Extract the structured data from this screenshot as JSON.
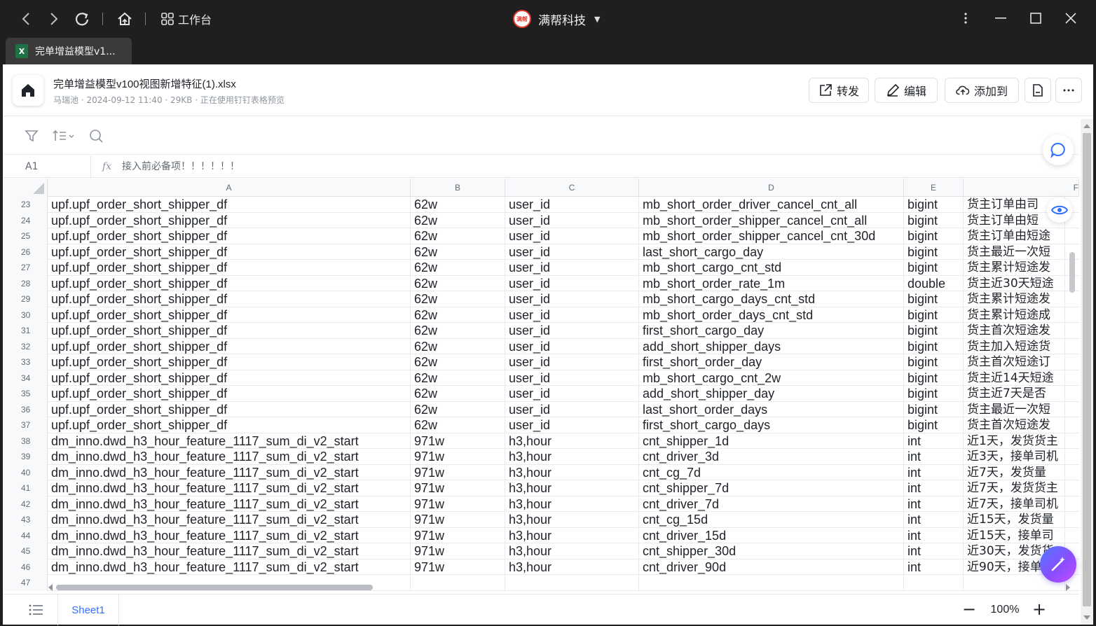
{
  "titlebar": {
    "workbench_label": "工作台",
    "brand_name": "满帮科技",
    "brand_logo_text": "满帮"
  },
  "tab": {
    "title": "完单增益模型v1..."
  },
  "file": {
    "name": "完单增益模型v100视图新增特征(1).xlsx",
    "meta": "马瑞池 · 2024-09-12 11:40 · 29KB · 正在使用钉钉表格预览"
  },
  "actions": {
    "forward": "转发",
    "edit": "编辑",
    "add_to": "添加到"
  },
  "formula_bar": {
    "cell_ref": "A1",
    "fx": "fx",
    "value": "接入前必备项！！！！！！"
  },
  "columns": [
    "A",
    "B",
    "C",
    "D",
    "E",
    "F"
  ],
  "rows": [
    {
      "n": "23",
      "a": "upf.upf_order_short_shipper_df",
      "b": "62w",
      "c": "user_id",
      "d": "mb_short_order_driver_cancel_cnt_all",
      "e": "bigint",
      "f": "货主订单由司"
    },
    {
      "n": "24",
      "a": "upf.upf_order_short_shipper_df",
      "b": "62w",
      "c": "user_id",
      "d": "mb_short_order_shipper_cancel_cnt_all",
      "e": "bigint",
      "f": "货主订单由短"
    },
    {
      "n": "25",
      "a": "upf.upf_order_short_shipper_df",
      "b": "62w",
      "c": "user_id",
      "d": "mb_short_order_shipper_cancel_cnt_30d",
      "e": "bigint",
      "f": "货主订单由短途"
    },
    {
      "n": "26",
      "a": "upf.upf_order_short_shipper_df",
      "b": "62w",
      "c": "user_id",
      "d": "last_short_cargo_day",
      "e": "bigint",
      "f": "货主最近一次短"
    },
    {
      "n": "27",
      "a": "upf.upf_order_short_shipper_df",
      "b": "62w",
      "c": "user_id",
      "d": "mb_short_cargo_cnt_std",
      "e": "bigint",
      "f": "货主累计短途发"
    },
    {
      "n": "28",
      "a": "upf.upf_order_short_shipper_df",
      "b": "62w",
      "c": "user_id",
      "d": "mb_short_order_rate_1m",
      "e": "double",
      "f": "货主近30天短途"
    },
    {
      "n": "29",
      "a": "upf.upf_order_short_shipper_df",
      "b": "62w",
      "c": "user_id",
      "d": "mb_short_cargo_days_cnt_std",
      "e": "bigint",
      "f": "货主累计短途发"
    },
    {
      "n": "30",
      "a": "upf.upf_order_short_shipper_df",
      "b": "62w",
      "c": "user_id",
      "d": "mb_short_order_days_cnt_std",
      "e": "bigint",
      "f": "货主累计短途成"
    },
    {
      "n": "31",
      "a": "upf.upf_order_short_shipper_df",
      "b": "62w",
      "c": "user_id",
      "d": "first_short_cargo_day",
      "e": "bigint",
      "f": "货主首次短途发"
    },
    {
      "n": "32",
      "a": "upf.upf_order_short_shipper_df",
      "b": "62w",
      "c": "user_id",
      "d": "add_short_shipper_days",
      "e": "bigint",
      "f": "货主加入短途货"
    },
    {
      "n": "33",
      "a": "upf.upf_order_short_shipper_df",
      "b": "62w",
      "c": "user_id",
      "d": "first_short_order_day",
      "e": "bigint",
      "f": "货主首次短途订"
    },
    {
      "n": "34",
      "a": "upf.upf_order_short_shipper_df",
      "b": "62w",
      "c": "user_id",
      "d": "mb_short_cargo_cnt_2w",
      "e": "bigint",
      "f": "货主近14天短途"
    },
    {
      "n": "35",
      "a": "upf.upf_order_short_shipper_df",
      "b": "62w",
      "c": "user_id",
      "d": "add_short_shipper_day",
      "e": "bigint",
      "f": "货主近7天是否"
    },
    {
      "n": "36",
      "a": "upf.upf_order_short_shipper_df",
      "b": "62w",
      "c": "user_id",
      "d": "last_short_order_days",
      "e": "bigint",
      "f": "货主最近一次短"
    },
    {
      "n": "37",
      "a": "upf.upf_order_short_shipper_df",
      "b": "62w",
      "c": "user_id",
      "d": "first_short_cargo_days",
      "e": "bigint",
      "f": "货主首次短途发"
    },
    {
      "n": "38",
      "a": "dm_inno.dwd_h3_hour_feature_1117_sum_di_v2_start",
      "b": "971w",
      "c": "h3,hour",
      "d": "cnt_shipper_1d",
      "e": "int",
      "f": "近1天，发货货主"
    },
    {
      "n": "39",
      "a": "dm_inno.dwd_h3_hour_feature_1117_sum_di_v2_start",
      "b": "971w",
      "c": "h3,hour",
      "d": "cnt_driver_3d",
      "e": "int",
      "f": "近3天，接单司机"
    },
    {
      "n": "40",
      "a": "dm_inno.dwd_h3_hour_feature_1117_sum_di_v2_start",
      "b": "971w",
      "c": "h3,hour",
      "d": "cnt_cg_7d",
      "e": "int",
      "f": "近7天，发货量"
    },
    {
      "n": "41",
      "a": "dm_inno.dwd_h3_hour_feature_1117_sum_di_v2_start",
      "b": "971w",
      "c": "h3,hour",
      "d": "cnt_shipper_7d",
      "e": "int",
      "f": "近7天，发货货主"
    },
    {
      "n": "42",
      "a": "dm_inno.dwd_h3_hour_feature_1117_sum_di_v2_start",
      "b": "971w",
      "c": "h3,hour",
      "d": "cnt_driver_7d",
      "e": "int",
      "f": "近7天，接单司机"
    },
    {
      "n": "43",
      "a": "dm_inno.dwd_h3_hour_feature_1117_sum_di_v2_start",
      "b": "971w",
      "c": "h3,hour",
      "d": "cnt_cg_15d",
      "e": "int",
      "f": "近15天，发货量"
    },
    {
      "n": "44",
      "a": "dm_inno.dwd_h3_hour_feature_1117_sum_di_v2_start",
      "b": "971w",
      "c": "h3,hour",
      "d": "cnt_driver_15d",
      "e": "int",
      "f": "近15天，接单司"
    },
    {
      "n": "45",
      "a": "dm_inno.dwd_h3_hour_feature_1117_sum_di_v2_start",
      "b": "971w",
      "c": "h3,hour",
      "d": "cnt_shipper_30d",
      "e": "int",
      "f": "近30天，发货货"
    },
    {
      "n": "46",
      "a": "dm_inno.dwd_h3_hour_feature_1117_sum_di_v2_start",
      "b": "971w",
      "c": "h3,hour",
      "d": "cnt_driver_90d",
      "e": "int",
      "f": "近90天，接单司"
    },
    {
      "n": "47",
      "a": "",
      "b": "",
      "c": "",
      "d": "",
      "e": "",
      "f": ""
    }
  ],
  "footer": {
    "sheet_name": "Sheet1",
    "zoom": "100%"
  },
  "colors": {
    "accent": "#3370ff",
    "titlebar_bg": "#1f1f1f"
  }
}
